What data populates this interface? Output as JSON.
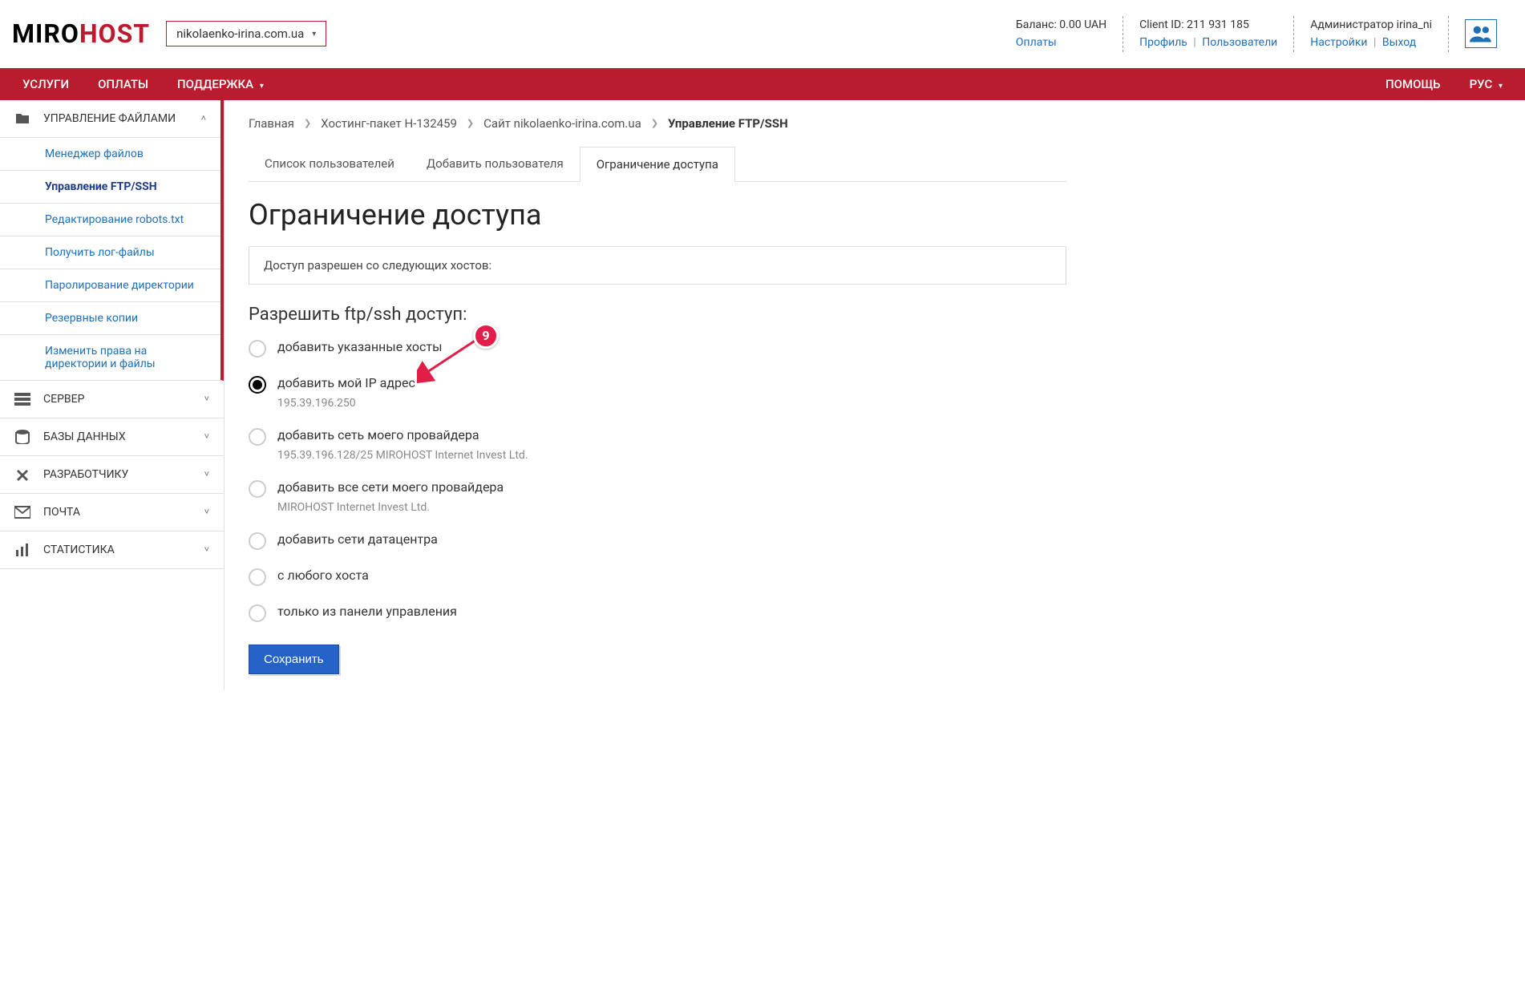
{
  "logo": {
    "p1": "MIRO",
    "p2": "HOST"
  },
  "domain_selector": "nikolaenko-irina.com.ua",
  "top_bar": {
    "balance_label": "Баланс: 0.00 UAH",
    "payments_link": "Оплаты",
    "client_id_label": "Client ID: 211 931 185",
    "profile_link": "Профиль",
    "users_link": "Пользователи",
    "admin_label": "Администратор irina_ni",
    "settings_link": "Настройки",
    "logout_link": "Выход"
  },
  "nav": {
    "services": "УСЛУГИ",
    "payments": "ОПЛАТЫ",
    "support": "ПОДДЕРЖКА",
    "help": "ПОМОЩЬ",
    "lang": "РУС"
  },
  "sidebar": {
    "files": {
      "title": "УПРАВЛЕНИЕ ФАЙЛАМИ",
      "items": [
        "Менеджер файлов",
        "Управление FTP/SSH",
        "Редактирование robots.txt",
        "Получить лог-файлы",
        "Паролирование директории",
        "Резервные копии",
        "Изменить права на директории и файлы"
      ]
    },
    "server": "СЕРВЕР",
    "db": "БАЗЫ ДАННЫХ",
    "dev": "РАЗРАБОТЧИКУ",
    "mail": "ПОЧТА",
    "stats": "СТАТИСТИКА"
  },
  "breadcrumb": {
    "home": "Главная",
    "package": "Хостинг-пакет H-132459",
    "site": "Сайт nikolaenko-irina.com.ua",
    "current": "Управление FTP/SSH"
  },
  "tabs": {
    "list": "Список пользователей",
    "add": "Добавить пользователя",
    "restrict": "Ограничение доступа"
  },
  "page": {
    "title": "Ограничение доступа",
    "info": "Доступ разрешен со следующих хостов:",
    "subtitle": "Разрешить ftp/ssh доступ:"
  },
  "options": {
    "o0": {
      "label": "добавить указанные хосты"
    },
    "o1": {
      "label": "добавить мой IP адрес",
      "detail": "195.39.196.250"
    },
    "o2": {
      "label": "добавить сеть моего провайдера",
      "detail": "195.39.196.128/25 MIROHOST Internet Invest Ltd."
    },
    "o3": {
      "label": "добавить все сети моего провайдера",
      "detail": "MIROHOST Internet Invest Ltd."
    },
    "o4": {
      "label": "добавить сети датацентра"
    },
    "o5": {
      "label": "с любого хоста"
    },
    "o6": {
      "label": "только из панели управления"
    }
  },
  "save_button": "Сохранить",
  "annotation_number": "9"
}
